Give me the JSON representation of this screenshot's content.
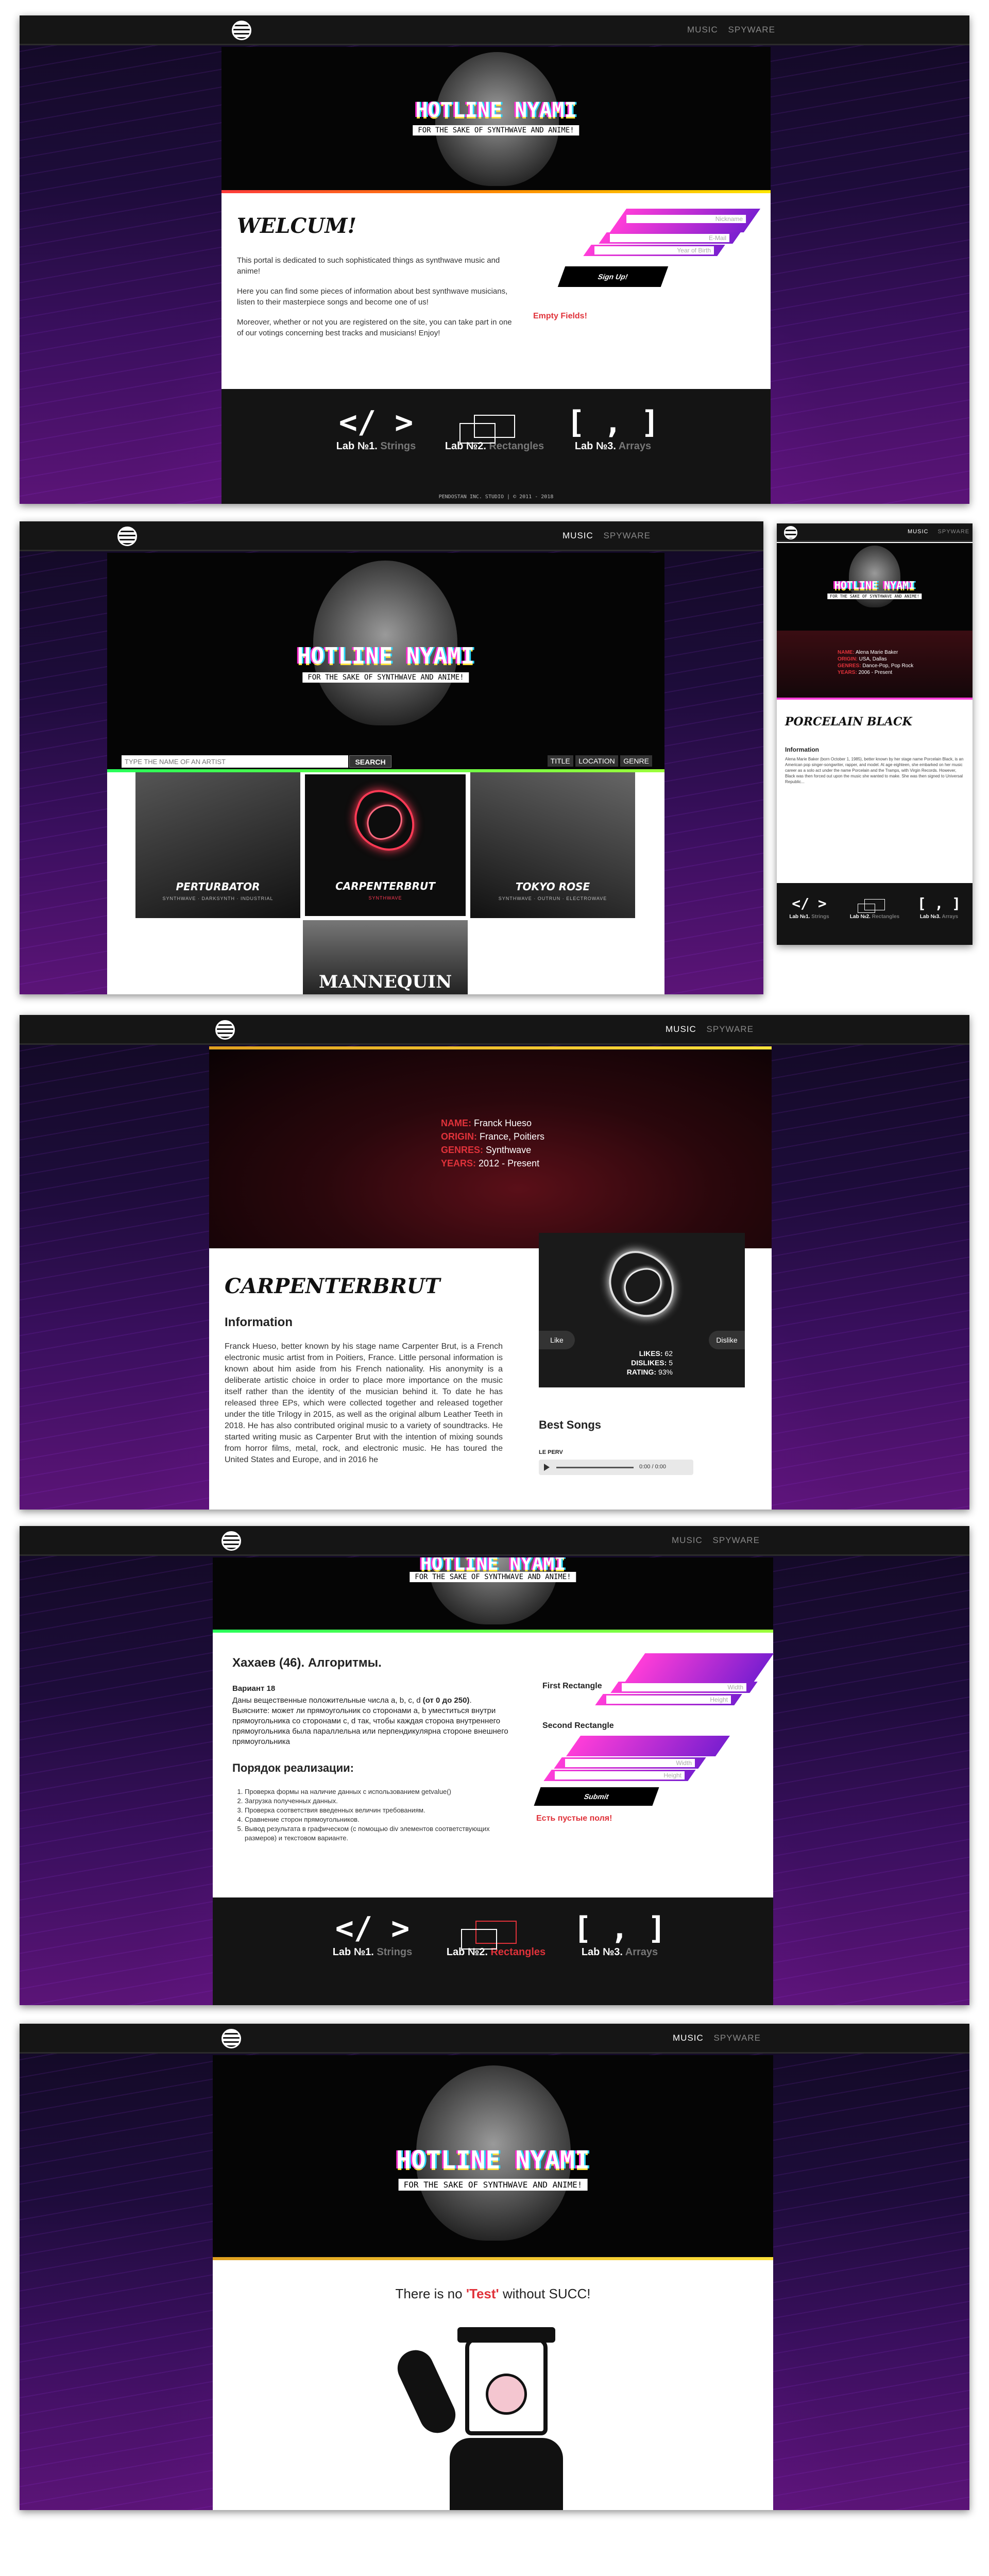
{
  "nav": {
    "music": "MUSIC",
    "spyware": "SPYWARE"
  },
  "brand": {
    "title": "HOTLINE NYAMI",
    "subtitle": "FOR THE SAKE OF SYNTHWAVE AND ANIME!"
  },
  "colors": {
    "accent_red": "#e0323a",
    "accent_pink": "#ff3dd8",
    "accent_purple": "#7b1fd0"
  },
  "labs": [
    {
      "glyph": "</ >",
      "num": "Lab №1.",
      "name": "Strings"
    },
    {
      "glyph": "",
      "num": "Lab №2.",
      "name": "Rectangles"
    },
    {
      "glyph": "[ , ]",
      "num": "Lab №3.",
      "name": "Arrays"
    }
  ],
  "home": {
    "heading": "WELCUM!",
    "paragraphs": [
      "This portal is dedicated to such sophisticated things as synthwave music and anime!",
      "Here you can find some pieces of information about best synthwave musicians, listen to their masterpiece songs and become one of us!",
      "Moreover, whether or not you are registered on the site, you can take part in one of our votings concerning best tracks and musicians! Enjoy!"
    ],
    "form": {
      "nickname": "Nickname",
      "email": "E-Mail",
      "year": "Year of Birth",
      "signup": "Sign Up!",
      "error": "Empty Fields!"
    },
    "footer_note": "PENDOSTAN INC. STUDIO | © 2011 - 2018"
  },
  "music": {
    "search_placeholder": "TYPE THE NAME OF AN ARTIST",
    "search_button": "SEARCH",
    "sort": [
      "TITLE",
      "LOCATION",
      "GENRE"
    ],
    "artists": [
      {
        "name": "PERTURBATOR",
        "tags": "SYNTHWAVE · DARKSYNTH · INDUSTRIAL"
      },
      {
        "name": "CARPENTERBRUT",
        "tags": "SYNTHWAVE"
      },
      {
        "name": "TOKYO ROSE",
        "tags": "SYNTHWAVE · OUTRUN · ELECTROWAVE"
      },
      {
        "name": "MANNEQUIN",
        "tags": ""
      }
    ]
  },
  "mobile": {
    "facts": [
      {
        "k": "NAME:",
        "v": "Alena Marie Baker"
      },
      {
        "k": "ORIGIN:",
        "v": "USA, Dallas"
      },
      {
        "k": "GENRES:",
        "v": "Dance-Pop, Pop Rock"
      },
      {
        "k": "YEARS:",
        "v": "2006 - Present"
      }
    ],
    "artist": "PORCELAIN BLACK",
    "info_heading": "Information",
    "info_text": "Alena Marie Baker (born October 1, 1985), better known by her stage name Porcelain Black, is an American pop singer-songwriter, rapper, and model. At age eighteen, she embarked on her music career as a solo act under the name Porcelain and the Tramps, with Virgin Records. However, Black was then forced out upon the music she wanted to make. She was then signed to Universal Republic..."
  },
  "artist": {
    "facts": [
      {
        "k": "NAME:",
        "v": "Franck Hueso"
      },
      {
        "k": "ORIGIN:",
        "v": "France, Poitiers"
      },
      {
        "k": "GENRES:",
        "v": "Synthwave"
      },
      {
        "k": "YEARS:",
        "v": "2012 - Present"
      }
    ],
    "name": "CARPENTERBRUT",
    "info_heading": "Information",
    "info_text": "Franck Hueso, better known by his stage name Carpenter Brut, is a French electronic music artist from in Poitiers, France. Little personal information is known about him aside from his French nationality. His anonymity is a deliberate artistic choice in order to place more importance on the music itself rather than the identity of the musician behind it. To date he has released three EPs, which were collected together and released together under the title Trilogy in 2015, as well as the original album Leather Teeth in 2018. He has also contributed original music to a variety of soundtracks. He started writing music as Carpenter Brut with the intention of mixing sounds from horror films, metal, rock, and electronic music. He has toured the United States and Europe, and in 2016 he",
    "like": "Like",
    "dislike": "Dislike",
    "likes_label": "LIKES:",
    "likes": "62",
    "dislikes_label": "DISLIKES:",
    "dislikes": "5",
    "rating_label": "RATING:",
    "rating": "93%",
    "songs_heading": "Best Songs",
    "song": "LE PERV",
    "time": "0:00 / 0:00"
  },
  "lab2": {
    "heading": "Хахаев (46). Алгоритмы.",
    "variant": "Вариант 18",
    "task_pre": "Даны вещественные положительные числа a, b, c, d ",
    "task_bold": "(от 0 до 250)",
    "task_post": ". Выясните: может ли прямоугольник со сторонами a, b уместиться внутри прямоугольника со сторонами c, d так, чтобы каждая сторона внутреннего прямоугольника была параллельна или перпендикулярна стороне внешнего прямоугольника",
    "order_heading": "Порядок реализации:",
    "steps": [
      "Проверка формы на наличие данных с использованием getvalue()",
      "Загрузка полученных данных.",
      "Проверка соответствия введенных величин требованиям.",
      "Сравнение сторон прямоугольников.",
      "Вывод результата в графическом (с помощью div элементов соответствующих размеров) и текстовом варианте."
    ],
    "first_rect": "First Rectangle",
    "second_rect": "Second Rectangle",
    "width": "Width",
    "height": "Height",
    "submit": "Submit",
    "error": "Есть пустые поля!"
  },
  "test": {
    "pre": "There is no ",
    "mid": "'Test'",
    "post": " without SUCC!"
  }
}
